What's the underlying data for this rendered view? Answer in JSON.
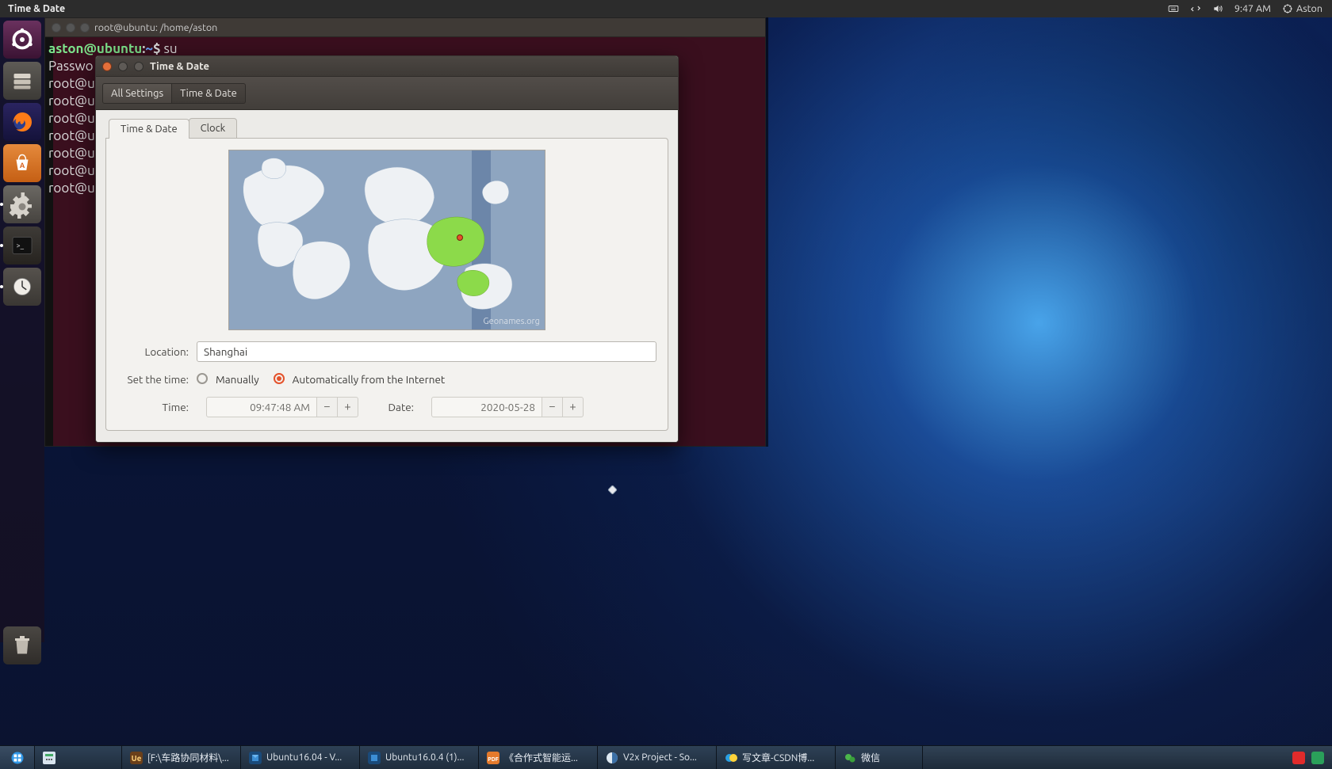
{
  "top_panel": {
    "title": "Time & Date",
    "clock": "9:47 AM",
    "user": "Aston"
  },
  "terminal": {
    "title": "root@ubuntu: /home/aston",
    "prompt_user": "aston@ubuntu",
    "prompt_sep": ":",
    "prompt_path": "~",
    "prompt_symbol": "$",
    "command": "su",
    "lines": [
      "Passwo",
      "root@u",
      "root@u",
      "root@u",
      "root@u",
      "root@u",
      "root@u",
      "root@u"
    ]
  },
  "settings": {
    "window_title": "Time & Date",
    "toolbar": {
      "all_settings": "All Settings",
      "current": "Time & Date"
    },
    "tabs": {
      "timedate": "Time & Date",
      "clock": "Clock"
    },
    "map_credit": "Geonames.org",
    "location_label": "Location:",
    "location_value": "Shanghai",
    "set_time_label": "Set the time:",
    "opt_manual": "Manually",
    "opt_auto": "Automatically from the Internet",
    "time_label": "Time:",
    "time_value": "09:47:48 AM",
    "date_label": "Date:",
    "date_value": "2020-05-28",
    "minus": "−",
    "plus": "+"
  },
  "taskbar": {
    "items": [
      "[F:\\车路协同材料\\...",
      "Ubuntu16.04  -  V...",
      "Ubuntu16.0.4 (1)...",
      "《合作式智能运...",
      "V2x Project - So...",
      "写文章-CSDN博...",
      "微信"
    ]
  }
}
